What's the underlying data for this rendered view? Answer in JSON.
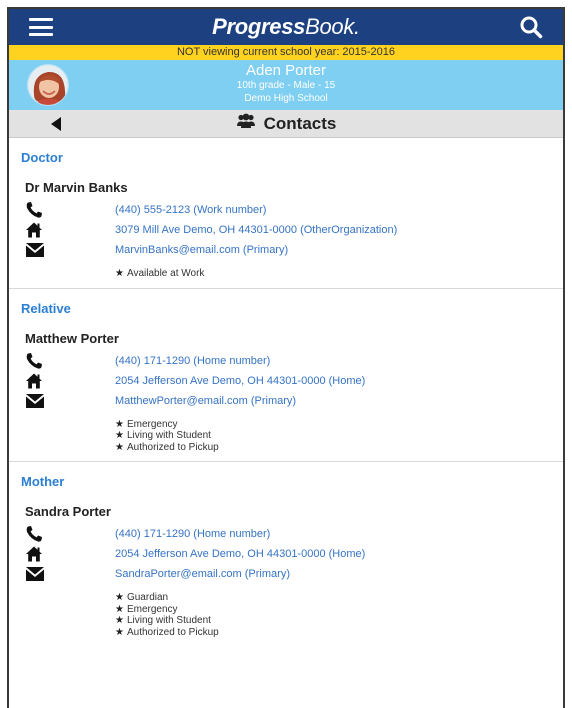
{
  "header": {
    "logo_bold": "Progress",
    "logo_thin": "Book.",
    "notice": "NOT viewing current school year: 2015-2016"
  },
  "student": {
    "name": "Aden Porter",
    "details": "10th grade - Male - 15",
    "school": "Demo High School"
  },
  "page": {
    "title": "Contacts"
  },
  "sections": [
    {
      "heading": "Doctor",
      "name": "Dr Marvin Banks",
      "phone": "(440) 555-2123 (Work number)",
      "address": "3079 Mill Ave Demo, OH 44301-0000 (OtherOrganization)",
      "email": "MarvinBanks@email.com (Primary)",
      "flags": [
        "Available at Work"
      ]
    },
    {
      "heading": "Relative",
      "name": "Matthew Porter",
      "phone": "(440) 171-1290 (Home number)",
      "address": "2054 Jefferson Ave Demo, OH 44301-0000 (Home)",
      "email": "MatthewPorter@email.com (Primary)",
      "flags": [
        "Emergency",
        "Living with Student",
        "Authorized to Pickup"
      ]
    },
    {
      "heading": "Mother",
      "name": "Sandra Porter",
      "phone": "(440) 171-1290 (Home number)",
      "address": "2054 Jefferson Ave Demo, OH 44301-0000 (Home)",
      "email": "SandraPorter@email.com (Primary)",
      "flags": [
        "Guardian",
        "Emergency",
        "Living with Student",
        "Authorized to Pickup"
      ]
    }
  ],
  "colors": {
    "topbar": "#1d4180",
    "notice": "#ffd21f",
    "student_band": "#7fcff2",
    "section_heading": "#2b7fd4",
    "link": "#3573c5"
  }
}
